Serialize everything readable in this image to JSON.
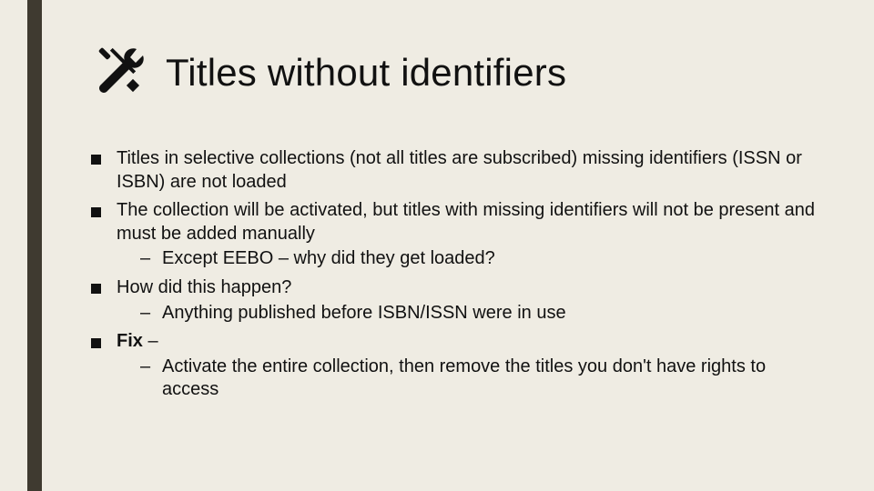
{
  "title": "Titles without identifiers",
  "bullets": {
    "b1": "Titles in selective collections (not all titles are subscribed) missing identifiers (ISSN or ISBN) are not loaded",
    "b2": "The collection will be activated, but titles with missing identifiers will not be present and must be added manually",
    "b2s1": "Except EEBO – why did they get loaded?",
    "b3": "How did this happen?",
    "b3s1": "Anything published before ISBN/ISSN were in use",
    "b4_bold": "Fix",
    "b4_rest": " –",
    "b4s1": "Activate the entire collection, then remove the titles you don't have rights to access"
  },
  "colors": {
    "background": "#efece3",
    "accent_bar": "#3f3a30",
    "text": "#111111"
  }
}
